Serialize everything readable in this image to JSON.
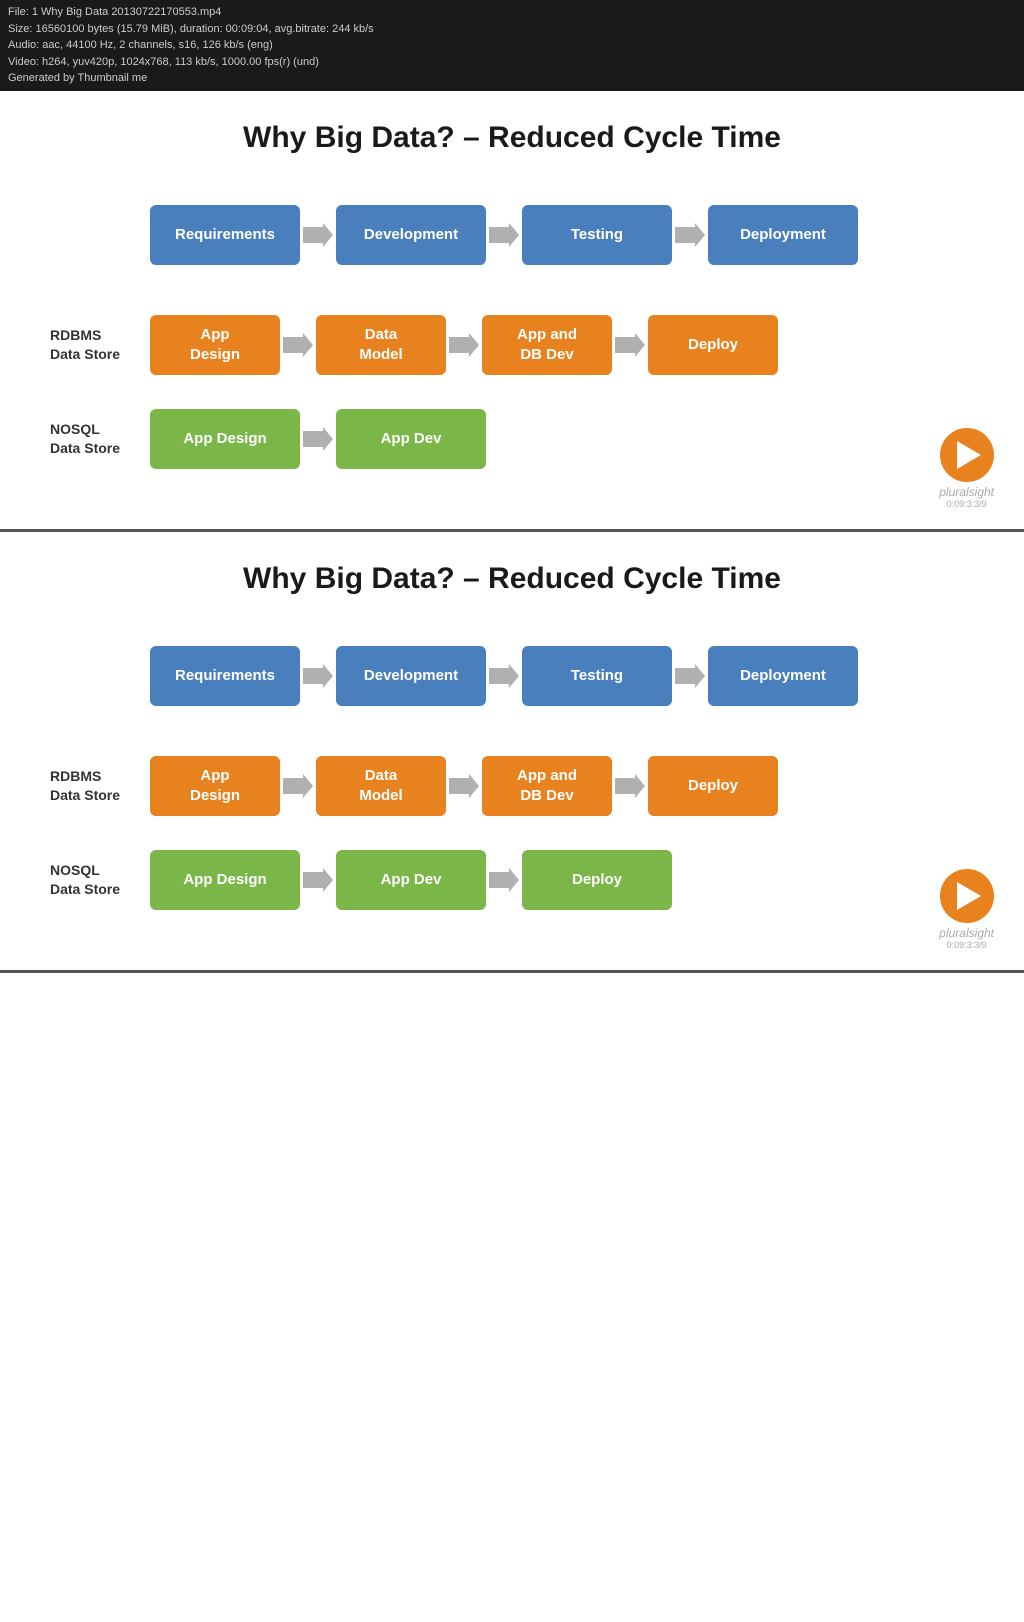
{
  "metadata": {
    "line1": "File: 1 Why Big Data 20130722170553.mp4",
    "line2": "Size: 16560100 bytes (15.79 MiB), duration: 00:09:04, avg.bitrate: 244 kb/s",
    "line3": "Audio: aac, 44100 Hz, 2 channels, s16, 126 kb/s (eng)",
    "line4": "Video: h264, yuv420p, 1024x768, 113 kb/s, 1000.00 fps(r) (und)",
    "line5": "Generated by Thumbnail me"
  },
  "slides": [
    {
      "id": "slide1",
      "title": "Why Big Data? – Reduced Cycle Time",
      "top_row": [
        "Requirements",
        "Development",
        "Testing",
        "Deployment"
      ],
      "rdbms_label": "RDBMS\nData Store",
      "rdbms_row": [
        "App\nDesign",
        "Data\nModel",
        "App and\nDB Dev",
        "Deploy"
      ],
      "nosql_label": "NOSQL\nData Store",
      "nosql_row": [
        "App Design",
        "App Dev"
      ]
    },
    {
      "id": "slide2",
      "title": "Why Big Data? – Reduced Cycle Time",
      "top_row": [
        "Requirements",
        "Development",
        "Testing",
        "Deployment"
      ],
      "rdbms_label": "RDBMS\nData Store",
      "rdbms_row": [
        "App\nDesign",
        "Data\nModel",
        "App and\nDB Dev",
        "Deploy"
      ],
      "nosql_label": "NOSQL\nData Store",
      "nosql_row": [
        "App Design",
        "App Dev",
        "Deploy"
      ]
    }
  ],
  "pluralsight": {
    "label": "pluralsight",
    "sublabel": "0:09:3:3/9"
  },
  "colors": {
    "blue": "#4a7fbd",
    "orange": "#e8821e",
    "green": "#7ab648",
    "arrow_fill": "#b0b0b0"
  }
}
